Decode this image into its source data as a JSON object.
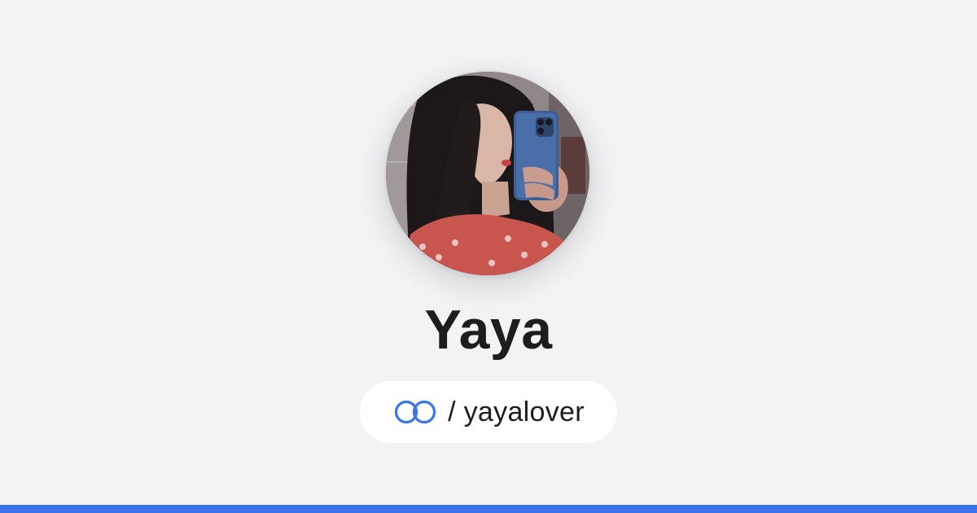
{
  "profile": {
    "name": "Yaya",
    "handle_text": "/ yayalover"
  },
  "icons": {
    "brand": "link-rings-icon",
    "avatar": "profile-photo-avatar"
  },
  "colors": {
    "background": "#f3f3f5",
    "accent": "#3b74e8",
    "text": "#1d1d1f",
    "pill": "#ffffff"
  }
}
